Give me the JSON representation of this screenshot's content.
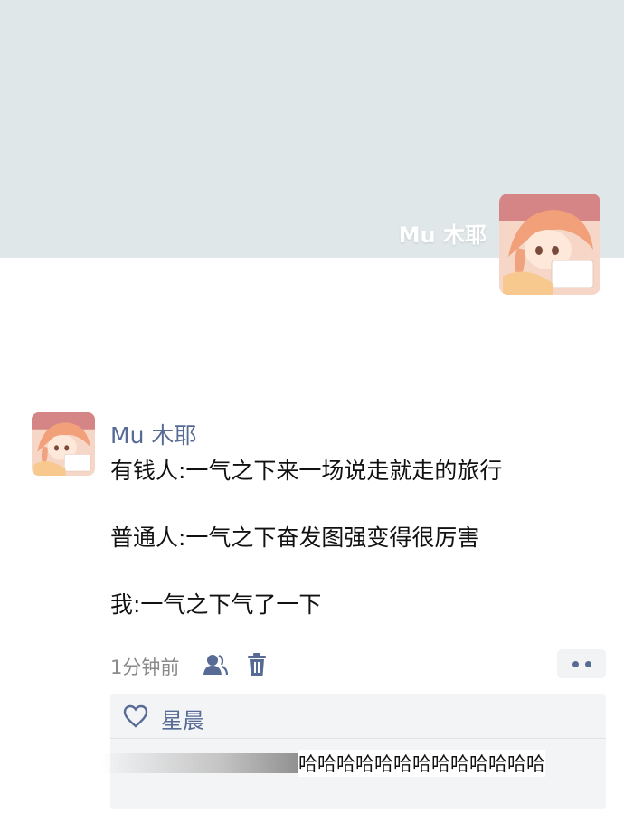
{
  "cover": {
    "user_name": "Mu 木耶"
  },
  "moment": {
    "author": "Mu 木耶",
    "lines": [
      "有钱人:一气之下来一场说走就走的旅行",
      "普通人:一气之下奋发图强变得很厉害",
      "我:一气之下气了一下"
    ],
    "time": "1分钟前",
    "icons": {
      "visibility": "friends-visibility-icon",
      "delete": "trash-icon",
      "more": "more-dots-icon",
      "like": "heart-icon"
    }
  },
  "interactions": {
    "likes": [
      "星晨"
    ],
    "comment_text": "哈哈哈哈哈哈哈哈哈哈哈哈哈"
  },
  "colors": {
    "cover_bg": "#dfe7e8",
    "link": "#576b95",
    "text": "#111111",
    "muted": "#8a8a8a",
    "panel": "#f3f4f6"
  }
}
